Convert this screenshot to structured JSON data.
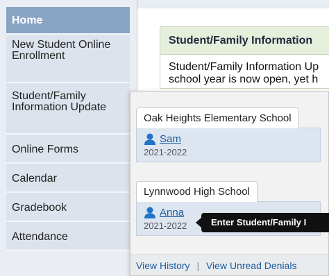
{
  "sidebar": {
    "items": [
      {
        "label": "Home"
      },
      {
        "label": "New Student Online Enrollment"
      },
      {
        "label": "Student/Family Information Update"
      },
      {
        "label": "Online Forms"
      },
      {
        "label": "Calendar"
      },
      {
        "label": "Gradebook"
      },
      {
        "label": "Attendance"
      }
    ]
  },
  "panel": {
    "title": "Student/Family Information",
    "line1": "Student/Family Information Up",
    "line2": "school year is now open, yet h"
  },
  "edge": {
    "f": "f",
    "p": "p"
  },
  "popover": {
    "schools": [
      {
        "name": "Oak Heights Elementary School",
        "student": "Sam",
        "year": "2021-2022"
      },
      {
        "name": "Lynnwood High School",
        "student": "Anna",
        "year": "2021-2022"
      }
    ],
    "view_history": "View History",
    "separator": "|",
    "view_unread_denials": "View Unread Denials"
  },
  "tooltip": {
    "text": "Enter Student/Family I"
  },
  "colors": {
    "accent": "#8aa4c4",
    "link": "#1f5c9e",
    "tooltip_bg": "#111111"
  }
}
